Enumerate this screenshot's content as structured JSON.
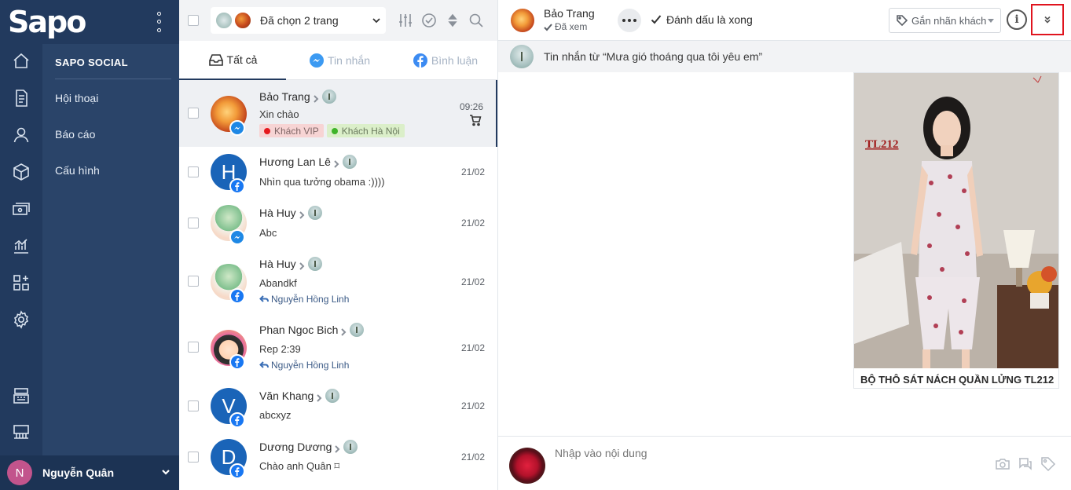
{
  "brand": {
    "logo": "Sapo"
  },
  "nav": {
    "heading": "SAPO SOCIAL",
    "items": [
      "Hội thoại",
      "Báo cáo",
      "Cấu hình"
    ]
  },
  "user": {
    "initial": "N",
    "name": "Nguyễn Quân"
  },
  "toolbar": {
    "page_select": "Đã chọn 2 trang"
  },
  "tabs": [
    "Tất cả",
    "Tin nhắn",
    "Bình luận"
  ],
  "conversations": [
    {
      "name": "Bảo Trang",
      "message": "Xin chào",
      "time": "09:26",
      "tags": [
        {
          "label": "Khách VIP",
          "color": "#e5191e"
        },
        {
          "label": "Khách Hà Nội",
          "color": "#3fb42a"
        }
      ],
      "channel": "messenger"
    },
    {
      "name": "Hương Lan Lê",
      "message": "Nhìn qua tưởng obama :))))",
      "time": "21/02",
      "initial": "H",
      "channel": "facebook"
    },
    {
      "name": "Hà Huy",
      "message": "Abc",
      "time": "21/02",
      "channel": "messenger"
    },
    {
      "name": "Hà Huy",
      "message": "Abandkf",
      "time": "21/02",
      "reply_by": "Nguyễn Hồng Linh",
      "channel": "facebook"
    },
    {
      "name": "Phan Ngoc Bich",
      "message": "Rep 2:39",
      "time": "21/02",
      "reply_by": "Nguyễn Hồng Linh",
      "channel": "facebook"
    },
    {
      "name": "Văn Khang",
      "message": "abcxyz",
      "time": "21/02",
      "initial": "V",
      "channel": "facebook"
    },
    {
      "name": "Dương Dương",
      "message": "Chào anh Quân ⌑",
      "time": "21/02",
      "initial": "D",
      "channel": "facebook"
    }
  ],
  "chat": {
    "name": "Bảo Trang",
    "status": "Đã xem",
    "mark_done": "Đánh dấu là xong",
    "tag_button": "Gắn nhãn khách",
    "info": "i",
    "source_text": "Tin nhắn từ  “Mưa gió thoáng qua tôi yêu em”",
    "product": {
      "code": "TL212",
      "title": "BỘ THÔ SÁT NÁCH QUẦN LỬNG TL212 ·"
    },
    "compose_placeholder": "Nhập vào nội dung"
  },
  "colors": {
    "sidebar": "#223a5e",
    "nav_panel": "#2a4469",
    "accent_highlight": "#e0141e",
    "messenger": "#1e88e5",
    "facebook": "#1877f2"
  }
}
